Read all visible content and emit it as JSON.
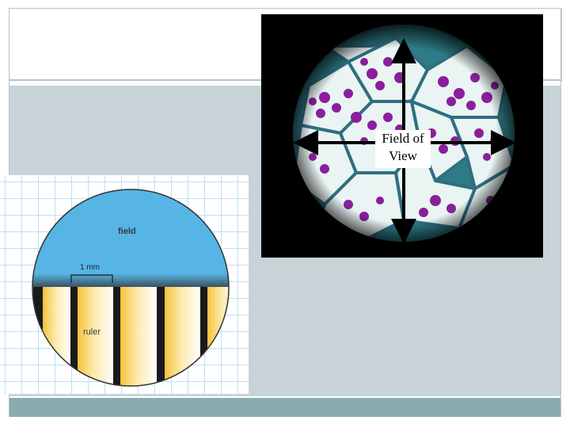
{
  "diagram": {
    "field_label": "field",
    "ruler_label": "ruler",
    "scale_label": "1 mm",
    "colors": {
      "field": "#56b5e5",
      "ruler_light": "#fdf4dc",
      "ruler_dark": "#f7c23b",
      "ruler_stripe": "#1a1a1a",
      "grid": "#bfe0f2"
    }
  },
  "micrograph": {
    "label_line1": "Field of",
    "label_line2": "View",
    "colors": {
      "background": "#000000",
      "cell_wall": "#2e6f80",
      "cell_fill": "#e9f4f3",
      "granule": "#8a1f9c",
      "arrow": "#000000"
    }
  }
}
